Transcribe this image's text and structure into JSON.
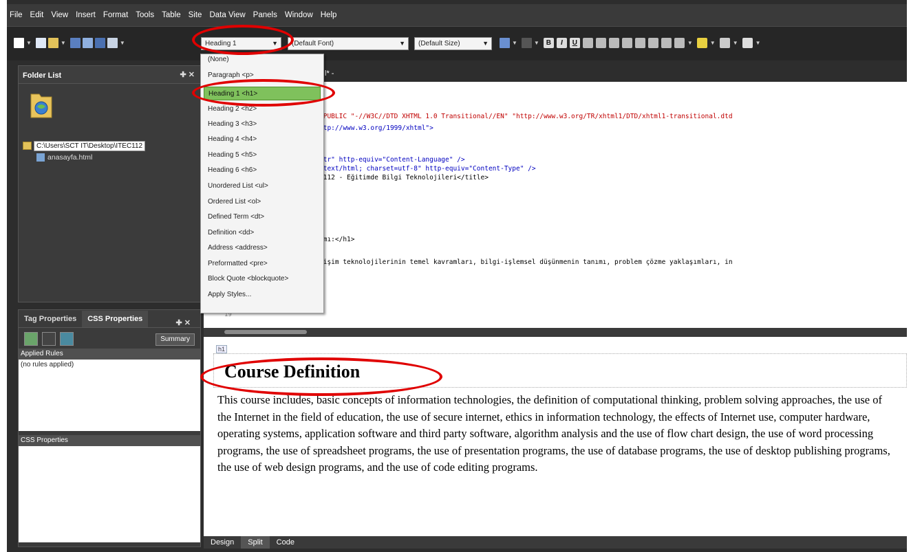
{
  "menu": [
    "File",
    "Edit",
    "View",
    "Insert",
    "Format",
    "Tools",
    "Table",
    "Site",
    "Data View",
    "Panels",
    "Window",
    "Help"
  ],
  "toolbar": {
    "style_value": "Heading 1",
    "font_value": "(Default Font)",
    "size_value": "(Default Size)"
  },
  "style_menu": {
    "items": [
      "(None)",
      "Paragraph <p>",
      "Heading 1 <h1>",
      "Heading 2 <h2>",
      "Heading 3 <h3>",
      "Heading 4 <h4>",
      "Heading 5 <h5>",
      "Heading 6 <h6>",
      "Unordered List <ul>",
      "Ordered List <ol>",
      "Defined Term <dt>",
      "Definition <dd>",
      "Address <address>",
      "Preformatted <pre>",
      "Block Quote <blockquote>",
      "Apply Styles..."
    ],
    "selected_index": 2
  },
  "folder_pane": {
    "title": "Folder List",
    "path": "C:\\Users\\SCT IT\\Desktop\\ITEC112",
    "file": "anasayfa.html"
  },
  "css_pane": {
    "tab_tag": "Tag Properties",
    "tab_css": "CSS Properties",
    "summary": "Summary",
    "applied_rules_title": "Applied Rules",
    "applied_rules_value": "(no rules applied)",
    "css_properties_title": "CSS Properties"
  },
  "editor": {
    "doc_tab": "l* -",
    "code_lines": [
      " PUBLIC \"-//W3C//DTD XHTML 1.0 Transitional//EN\" \"http://www.w3.org/TR/xhtml1/DTD/xhtml1-transitional.dtd",
      "ctp://www.w3.org/1999/xhtml\">",
      "\"tr\" http-equiv=\"Content-Language\" />",
      "\"text/html; charset=utf-8\" http-equiv=\"Content-Type\" />",
      "C112 - Eğitimde Bilgi Teknolojileri</title>",
      "ımı:</h1>",
      "lişim teknolojilerinin temel kavramları, bilgi-işlemsel düşünmenin tanımı, problem çözme yaklaşımları, in"
    ],
    "last_line_number": "19",
    "h1_tag": "h1",
    "heading": "Course Definition",
    "paragraph": "This course includes, basic concepts of information technologies, the definition of computational thinking, problem solving approaches, the use of the Internet in the field of education, the use of secure internet, ethics in information technology, the effects of Internet use, computer hardware, operating systems, application software and third party software, algorithm analysis and the use of flow chart design, the use of word processing programs, the use of spreadsheet programs, the use of presentation programs, the use of database programs, the use of desktop publishing programs, the use of web design programs, and the use of code editing programs.",
    "view_tabs": [
      "Design",
      "Split",
      "Code"
    ]
  },
  "colors": {
    "highlight_oval": "#e00000",
    "menu_selected": "#7fc15c"
  }
}
